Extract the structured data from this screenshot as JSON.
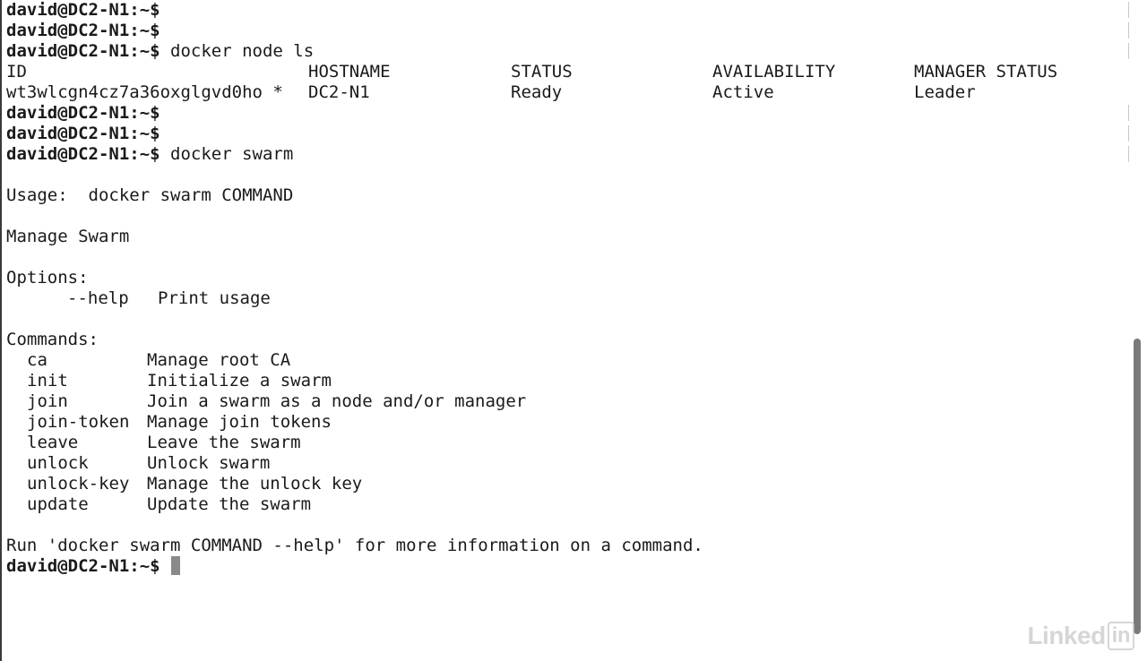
{
  "terminal": {
    "prompt": "david@DC2-N1:~$",
    "lines_top": [
      {
        "prompt": "david@DC2-N1:~$",
        "cmd": ""
      },
      {
        "prompt": "david@DC2-N1:~$",
        "cmd": ""
      },
      {
        "prompt": "david@DC2-N1:~$",
        "cmd": " docker node ls"
      }
    ],
    "node_table": {
      "headers": [
        "ID",
        "HOSTNAME",
        "STATUS",
        "AVAILABILITY",
        "MANAGER STATUS"
      ],
      "rows": [
        [
          "wt3wlcgn4cz7a36oxglgvd0ho *",
          "DC2-N1",
          "Ready",
          "Active",
          "Leader"
        ]
      ]
    },
    "lines_mid": [
      {
        "prompt": "david@DC2-N1:~$",
        "cmd": ""
      },
      {
        "prompt": "david@DC2-N1:~$",
        "cmd": ""
      },
      {
        "prompt": "david@DC2-N1:~$",
        "cmd": " docker swarm"
      }
    ],
    "usage": "Usage:  docker swarm COMMAND",
    "description": "Manage Swarm",
    "options_header": "Options:",
    "options": [
      {
        "flag": "--help",
        "desc": "Print usage"
      }
    ],
    "commands_header": "Commands:",
    "commands": [
      {
        "name": "ca",
        "desc": "Manage root CA"
      },
      {
        "name": "init",
        "desc": "Initialize a swarm"
      },
      {
        "name": "join",
        "desc": "Join a swarm as a node and/or manager"
      },
      {
        "name": "join-token",
        "desc": "Manage join tokens"
      },
      {
        "name": "leave",
        "desc": "Leave the swarm"
      },
      {
        "name": "unlock",
        "desc": "Unlock swarm"
      },
      {
        "name": "unlock-key",
        "desc": "Manage the unlock key"
      },
      {
        "name": "update",
        "desc": "Update the swarm"
      }
    ],
    "footer": "Run 'docker swarm COMMAND --help' for more information on a command.",
    "final_prompt": "david@DC2-N1:~$"
  },
  "watermark": {
    "text": "Linked",
    "box_text": "in"
  },
  "colors": {
    "background": "#ffffff",
    "text": "#1a1a1a",
    "cursor": "#8a8a8a",
    "scrollbar": "#7a7a7a"
  }
}
